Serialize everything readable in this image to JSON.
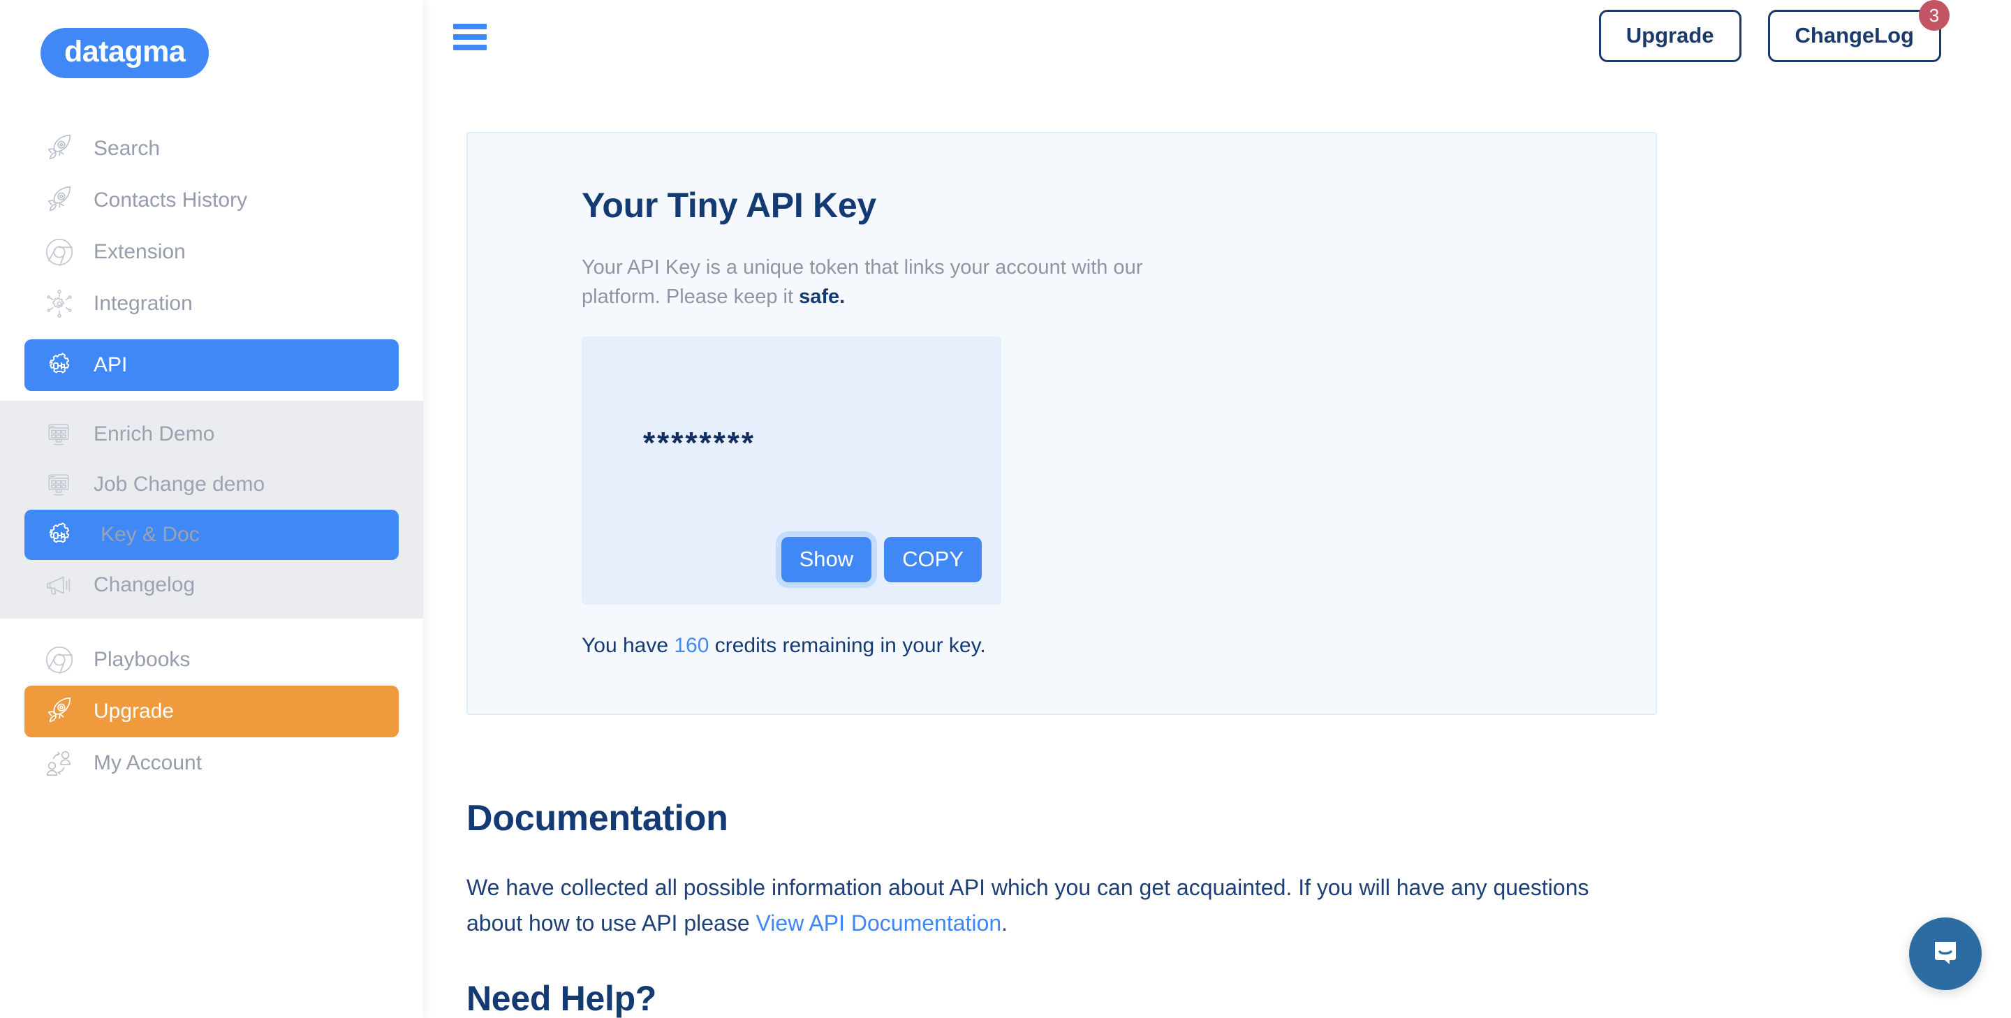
{
  "brand": {
    "logo_text": "datagma"
  },
  "sidebar": {
    "items": [
      {
        "label": "Search",
        "icon": "rocket-icon",
        "state": "default"
      },
      {
        "label": "Contacts History",
        "icon": "rocket-icon",
        "state": "default"
      },
      {
        "label": "Extension",
        "icon": "chrome-icon",
        "state": "default"
      },
      {
        "label": "Integration",
        "icon": "gear-network-icon",
        "state": "default"
      },
      {
        "label": "API",
        "icon": "gear-plug-icon",
        "state": "active"
      }
    ],
    "subitems": [
      {
        "label": "Enrich Demo",
        "icon": "monitor-grid-icon",
        "state": "default"
      },
      {
        "label": "Job Change demo",
        "icon": "monitor-grid-icon",
        "state": "default"
      },
      {
        "label": "Key & Doc",
        "icon": "gear-plug-icon",
        "state": "active"
      },
      {
        "label": "Changelog",
        "icon": "megaphone-icon",
        "state": "default"
      }
    ],
    "footer_items": [
      {
        "label": "Playbooks",
        "icon": "chrome-icon",
        "state": "default"
      },
      {
        "label": "Upgrade",
        "icon": "rocket-icon",
        "state": "orange"
      },
      {
        "label": "My Account",
        "icon": "people-exchange-icon",
        "state": "default"
      }
    ]
  },
  "topbar": {
    "menu_icon": "hamburger-icon",
    "upgrade_label": "Upgrade",
    "changelog_label": "ChangeLog",
    "changelog_badge": "3"
  },
  "key_card": {
    "title": "Your Tiny API Key",
    "description_lead": "Your API Key is a unique token that links your account with our platform. Please keep it ",
    "description_strong": "safe.",
    "masked_key": "********",
    "show_label": "Show",
    "copy_label": "COPY",
    "credits_prefix": "You have ",
    "credits_value": "160",
    "credits_suffix": " credits remaining in your key."
  },
  "documentation": {
    "title": "Documentation",
    "body_before_link": "We have collected all possible information about API which you can get acquainted. If you will have any questions about how to use API please ",
    "link_label": "View API Documentation",
    "body_after_link": ".",
    "need_help_title": "Need Help?"
  },
  "chat": {
    "icon": "intercom-chat-icon"
  },
  "colors": {
    "accent_blue": "#4188f7",
    "navy": "#143a74",
    "orange": "#ef9a3c",
    "badge_red": "#c25464",
    "card_bg": "#f5f9fe",
    "key_box_bg": "#e7effc",
    "subgroup_bg": "#eaecef",
    "intercom_blue": "#2c6ca3"
  }
}
